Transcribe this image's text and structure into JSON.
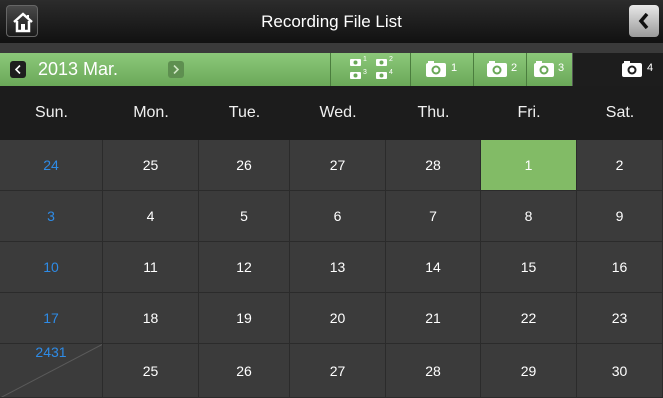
{
  "header": {
    "title": "Recording File List"
  },
  "month_nav": {
    "label": "2013 Mar."
  },
  "cameras": [
    {
      "id": "quad",
      "label": ""
    },
    {
      "id": "cam1",
      "label": "1"
    },
    {
      "id": "cam2",
      "label": "2"
    },
    {
      "id": "cam3",
      "label": "3"
    },
    {
      "id": "cam4",
      "label": "4"
    }
  ],
  "quad_labels": [
    "1",
    "2",
    "3",
    "4"
  ],
  "weekdays": [
    "Sun.",
    "Mon.",
    "Tue.",
    "Wed.",
    "Thu.",
    "Fri.",
    "Sat."
  ],
  "weeks": [
    [
      "24",
      "25",
      "26",
      "27",
      "28",
      "1",
      "2"
    ],
    [
      "3",
      "4",
      "5",
      "6",
      "7",
      "8",
      "9"
    ],
    [
      "10",
      "11",
      "12",
      "13",
      "14",
      "15",
      "16"
    ],
    [
      "17",
      "18",
      "19",
      "20",
      "21",
      "22",
      "23"
    ],
    [
      "24/31",
      "25",
      "26",
      "27",
      "28",
      "29",
      "30"
    ]
  ],
  "selected_date": "1",
  "selected_camera": "4",
  "colors": {
    "accent_green": "#82bb66",
    "sunday_blue": "#2e8be6"
  }
}
